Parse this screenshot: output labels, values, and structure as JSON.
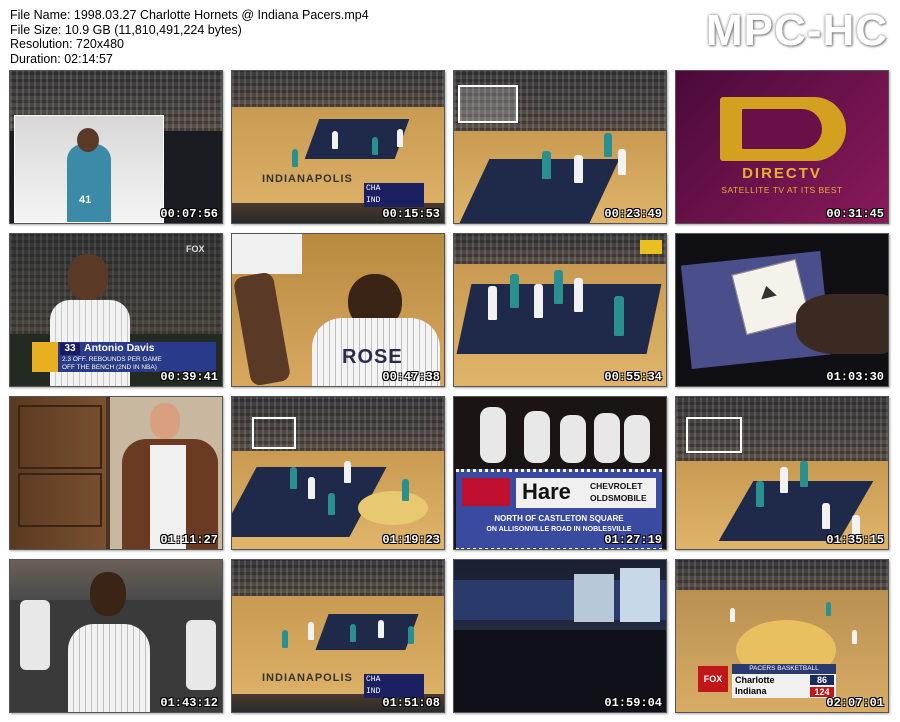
{
  "header": {
    "file_name": "File Name: 1998.03.27 Charlotte Hornets @ Indiana Pacers.mp4",
    "file_size": "File Size: 10.9 GB (11,810,491,224 bytes)",
    "resolution": "Resolution: 720x480",
    "duration": "Duration: 02:14:57"
  },
  "brand": "MPC-HC",
  "thumbnails": [
    {
      "timestamp": "00:07:56",
      "jersey": "41"
    },
    {
      "timestamp": "00:15:53",
      "banner": "INDIANAPOLIS",
      "score_top": "CHA",
      "score_bottom": "IND"
    },
    {
      "timestamp": "00:23:49"
    },
    {
      "timestamp": "00:31:45",
      "logo_text": "DIRECTV",
      "tagline": "SATELLITE TV AT ITS BEST"
    },
    {
      "timestamp": "00:39:41",
      "number": "33",
      "name": "Antonio Davis",
      "line1": "2.3 OFF. REBOUNDS PER GAME",
      "line2": "OFF THE BENCH (2ND IN NBA)",
      "net": "FOX"
    },
    {
      "timestamp": "00:47:38",
      "jersey_name": "ROSE"
    },
    {
      "timestamp": "00:55:34"
    },
    {
      "timestamp": "01:03:30"
    },
    {
      "timestamp": "01:11:27"
    },
    {
      "timestamp": "01:19:23"
    },
    {
      "timestamp": "01:27:19",
      "dealer": "Hare",
      "dealer_sub1": "CHEVROLET",
      "dealer_sub2": "OLDSMOBILE",
      "addr1": "NORTH OF CASTLETON SQUARE",
      "addr2": "ON ALLISONVILLE ROAD IN NOBLESVILLE"
    },
    {
      "timestamp": "01:35:15"
    },
    {
      "timestamp": "01:43:12"
    },
    {
      "timestamp": "01:51:08",
      "banner": "INDIANAPOLIS",
      "score_top": "CHA",
      "score_bottom": "IND"
    },
    {
      "timestamp": "01:59:04"
    },
    {
      "timestamp": "02:07:01",
      "header_bar": "PACERS BASKETBALL",
      "team1": "Charlotte",
      "score1": "86",
      "team2": "Indiana",
      "score2": "124",
      "net": "FOX"
    }
  ]
}
